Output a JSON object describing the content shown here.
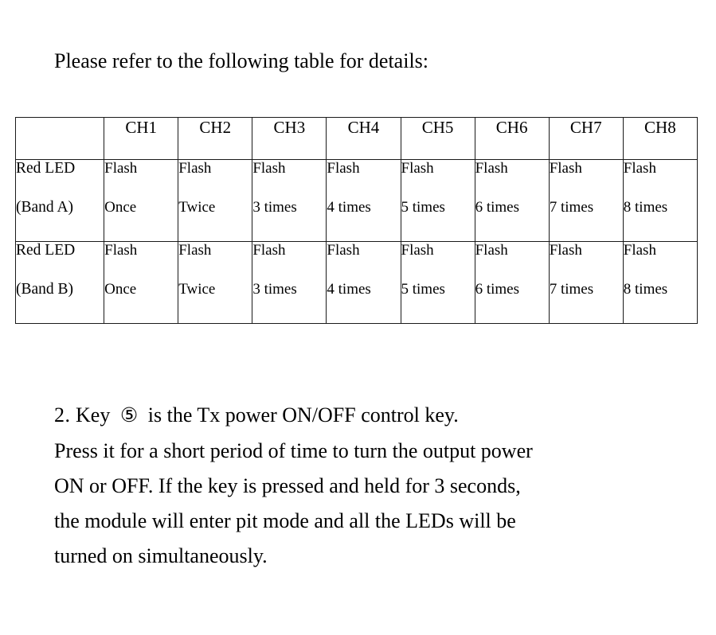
{
  "document": {
    "intro_text": "Please refer to the following table for details:",
    "table": {
      "headers": [
        "",
        "CH1",
        "CH2",
        "CH3",
        "CH4",
        "CH5",
        "CH6",
        "CH7",
        "CH8"
      ],
      "rows": [
        {
          "label_line1": "Red LED",
          "label_line2": "(Band A)",
          "cells": [
            {
              "line1": "Flash",
              "line2": "Once"
            },
            {
              "line1": "Flash",
              "line2": "Twice"
            },
            {
              "line1": "Flash",
              "line2": "3 times"
            },
            {
              "line1": "Flash",
              "line2": "4 times"
            },
            {
              "line1": "Flash",
              "line2": "5 times"
            },
            {
              "line1": "Flash",
              "line2": "6 times"
            },
            {
              "line1": "Flash",
              "line2": "7 times"
            },
            {
              "line1": "Flash",
              "line2": "8 times"
            }
          ]
        },
        {
          "label_line1": "Red LED",
          "label_line2": "(Band B)",
          "cells": [
            {
              "line1": "Flash",
              "line2": "Once"
            },
            {
              "line1": "Flash",
              "line2": "Twice"
            },
            {
              "line1": "Flash",
              "line2": "3 times"
            },
            {
              "line1": "Flash",
              "line2": "4 times"
            },
            {
              "line1": "Flash",
              "line2": "5 times"
            },
            {
              "line1": "Flash",
              "line2": "6 times"
            },
            {
              "line1": "Flash",
              "line2": "7 times"
            },
            {
              "line1": "Flash",
              "line2": "8 times"
            }
          ]
        }
      ]
    },
    "paragraph": {
      "item_number": "2.",
      "lead_before_key": "Key",
      "key_symbol": "⑤",
      "lead_after_key": "is the Tx power ON/OFF control key.",
      "lines": [
        "Press it for a short period of time to turn the output power",
        "ON or OFF. If the key is pressed and held for 3 seconds,",
        "the module will enter pit mode and all the LEDs will be",
        "turned on simultaneously."
      ]
    }
  }
}
